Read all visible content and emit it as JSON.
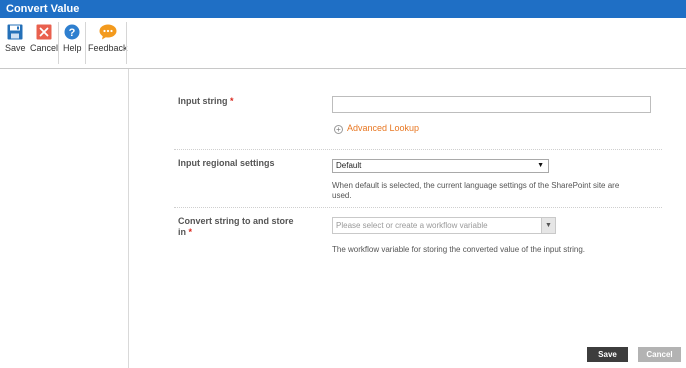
{
  "window": {
    "title": "Convert Value"
  },
  "ribbon": {
    "save_label": "Save",
    "cancel_label": "Cancel",
    "help_label": "Help",
    "feedback_label": "Feedback"
  },
  "form": {
    "input_string": {
      "label": "Input string",
      "required_mark": "*",
      "value": "",
      "advanced_lookup_label": "Advanced Lookup"
    },
    "regional_settings": {
      "label": "Input regional settings",
      "selected": "Default",
      "help_text_1": "When default is selected, the current language settings of the SharePoint site are",
      "help_text_2": "used."
    },
    "convert_to": {
      "label_line1": "Convert string to and store",
      "label_line2": "in",
      "required_mark": "*",
      "placeholder": "Please select or create a workflow variable",
      "help_text": "The workflow variable for storing the converted value of the input string."
    }
  },
  "footer": {
    "save_label": "Save",
    "cancel_label": "Cancel"
  },
  "colors": {
    "title_bar": "#1f6fc5",
    "save_icon": "#2470b8",
    "cancel_icon": "#e9604e",
    "help_icon": "#2e7fcf",
    "feedback_icon": "#f39a1d",
    "link": "#e87722",
    "required": "#d9261c"
  }
}
